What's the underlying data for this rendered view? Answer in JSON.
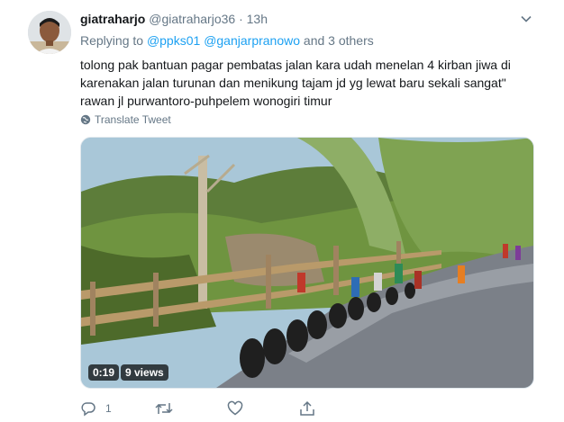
{
  "tweet": {
    "display_name": "giatraharjo",
    "handle": "@giatraharjo36",
    "separator": "·",
    "time": "13h",
    "replying_prefix": "Replying to",
    "reply_to_1": "@ppks01",
    "reply_to_2": "@ganjarpranowo",
    "reply_to_suffix": "and 3 others",
    "text": "tolong pak bantuan pagar pembatas jalan kara udah menelan 4 kirban jiwa di karenakan jalan turunan dan menikung tajam jd yg lewat baru sekali sangat\" rawan jl purwantoro-puhpelem wonogiri timur",
    "translate_label": "Translate Tweet"
  },
  "video": {
    "duration": "0:19",
    "views": "9 views"
  },
  "actions": {
    "reply_count": "1"
  },
  "icons": {
    "avatar": "user-avatar",
    "caret": "chevron-down-icon",
    "translate": "globe-icon",
    "reply": "reply-icon",
    "retweet": "retweet-icon",
    "like": "heart-icon",
    "share": "share-icon"
  },
  "colors": {
    "link": "#1da1f2",
    "secondary_text": "#657786",
    "primary_text": "#14171a"
  }
}
